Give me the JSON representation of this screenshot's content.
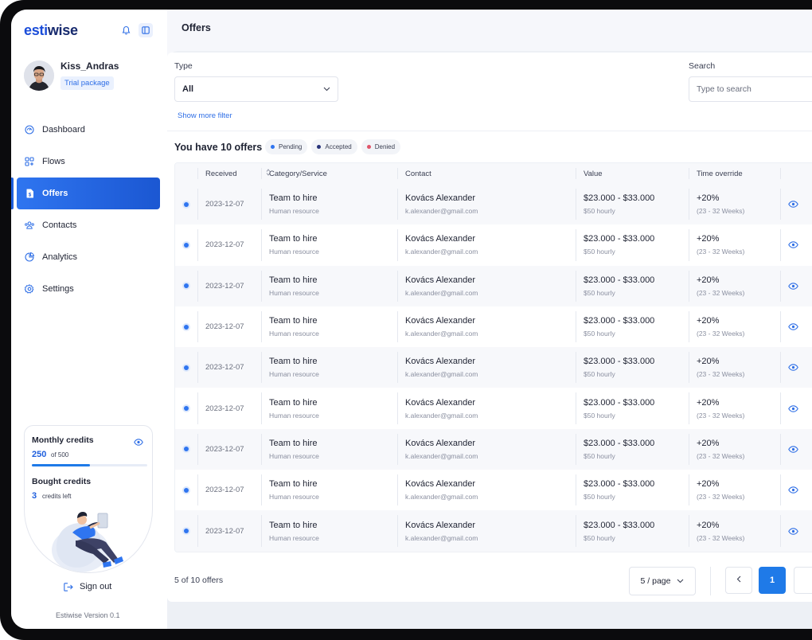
{
  "app": {
    "logo_part1": "esti",
    "logo_part2": "wise",
    "page_title": "Offers",
    "version": "Estiwise Version 0.1"
  },
  "user": {
    "name": "Kiss_Andras",
    "plan": "Trial package"
  },
  "nav": [
    {
      "label": "Dashboard",
      "icon": "dashboard-icon"
    },
    {
      "label": "Flows",
      "icon": "flows-icon"
    },
    {
      "label": "Offers",
      "icon": "offers-icon",
      "active": true
    },
    {
      "label": "Contacts",
      "icon": "contacts-icon"
    },
    {
      "label": "Analytics",
      "icon": "analytics-icon"
    },
    {
      "label": "Settings",
      "icon": "settings-icon"
    }
  ],
  "credits": {
    "monthly_title": "Monthly credits",
    "monthly_used": "250",
    "monthly_total": "of 500",
    "monthly_fraction": 0.5,
    "bought_title": "Bought credits",
    "bought_count": "3",
    "bought_suffix": "credits left"
  },
  "signout_label": "Sign out",
  "filters": {
    "type_label": "Type",
    "type_value": "All",
    "search_label": "Search",
    "search_placeholder": "Type to search",
    "more_filter": "Show more filter"
  },
  "offers_heading": "You have 10 offers",
  "status_chips": [
    {
      "label": "Pending",
      "color": "#2f75f0"
    },
    {
      "label": "Accepted",
      "color": "#27337a"
    },
    {
      "label": "Denied",
      "color": "#e0556a"
    }
  ],
  "table": {
    "headers": [
      "Received",
      "Category/Service",
      "Contact",
      "Value",
      "Time override"
    ],
    "rows": [
      {
        "received": "2023-12-07",
        "category": "Team to hire",
        "service": "Human resource",
        "contact": "Kovács Alexander",
        "email": "k.alexander@gmail.com",
        "value": "$23.000 - $33.000",
        "rate": "$50 hourly",
        "override": "+20%",
        "weeks": "(23 - 32 Weeks)"
      },
      {
        "received": "2023-12-07",
        "category": "Team to hire",
        "service": "Human resource",
        "contact": "Kovács Alexander",
        "email": "k.alexander@gmail.com",
        "value": "$23.000 - $33.000",
        "rate": "$50 hourly",
        "override": "+20%",
        "weeks": "(23 - 32 Weeks)"
      },
      {
        "received": "2023-12-07",
        "category": "Team to hire",
        "service": "Human resource",
        "contact": "Kovács Alexander",
        "email": "k.alexander@gmail.com",
        "value": "$23.000 - $33.000",
        "rate": "$50 hourly",
        "override": "+20%",
        "weeks": "(23 - 32 Weeks)"
      },
      {
        "received": "2023-12-07",
        "category": "Team to hire",
        "service": "Human resource",
        "contact": "Kovács Alexander",
        "email": "k.alexander@gmail.com",
        "value": "$23.000 - $33.000",
        "rate": "$50 hourly",
        "override": "+20%",
        "weeks": "(23 - 32 Weeks)"
      },
      {
        "received": "2023-12-07",
        "category": "Team to hire",
        "service": "Human resource",
        "contact": "Kovács Alexander",
        "email": "k.alexander@gmail.com",
        "value": "$23.000 - $33.000",
        "rate": "$50 hourly",
        "override": "+20%",
        "weeks": "(23 - 32 Weeks)"
      },
      {
        "received": "2023-12-07",
        "category": "Team to hire",
        "service": "Human resource",
        "contact": "Kovács Alexander",
        "email": "k.alexander@gmail.com",
        "value": "$23.000 - $33.000",
        "rate": "$50 hourly",
        "override": "+20%",
        "weeks": "(23 - 32 Weeks)"
      },
      {
        "received": "2023-12-07",
        "category": "Team to hire",
        "service": "Human resource",
        "contact": "Kovács Alexander",
        "email": "k.alexander@gmail.com",
        "value": "$23.000 - $33.000",
        "rate": "$50 hourly",
        "override": "+20%",
        "weeks": "(23 - 32 Weeks)"
      },
      {
        "received": "2023-12-07",
        "category": "Team to hire",
        "service": "Human resource",
        "contact": "Kovács Alexander",
        "email": "k.alexander@gmail.com",
        "value": "$23.000 - $33.000",
        "rate": "$50 hourly",
        "override": "+20%",
        "weeks": "(23 - 32 Weeks)"
      },
      {
        "received": "2023-12-07",
        "category": "Team to hire",
        "service": "Human resource",
        "contact": "Kovács Alexander",
        "email": "k.alexander@gmail.com",
        "value": "$23.000 - $33.000",
        "rate": "$50 hourly",
        "override": "+20%",
        "weeks": "(23 - 32 Weeks)"
      }
    ]
  },
  "pagination": {
    "count_text": "5 of 10 offers",
    "page_size": "5 / page",
    "current_page": "1"
  }
}
